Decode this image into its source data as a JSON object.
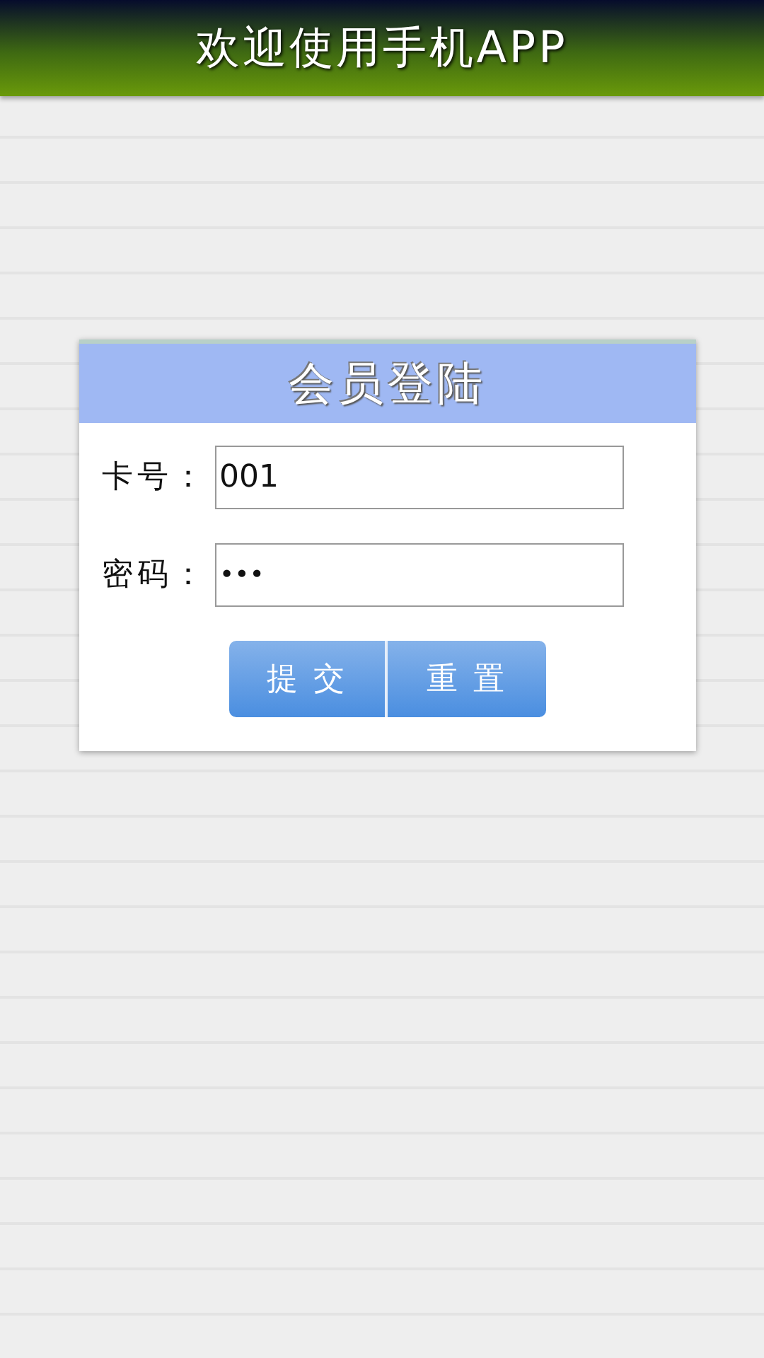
{
  "header": {
    "title": "欢迎使用手机APP"
  },
  "login": {
    "title": "会员登陆",
    "fields": [
      {
        "label": "卡号：",
        "value": "001",
        "kind": "text"
      },
      {
        "label": "密码：",
        "value": "•••",
        "kind": "password"
      }
    ],
    "buttons": [
      "提 交",
      "重 置"
    ]
  }
}
